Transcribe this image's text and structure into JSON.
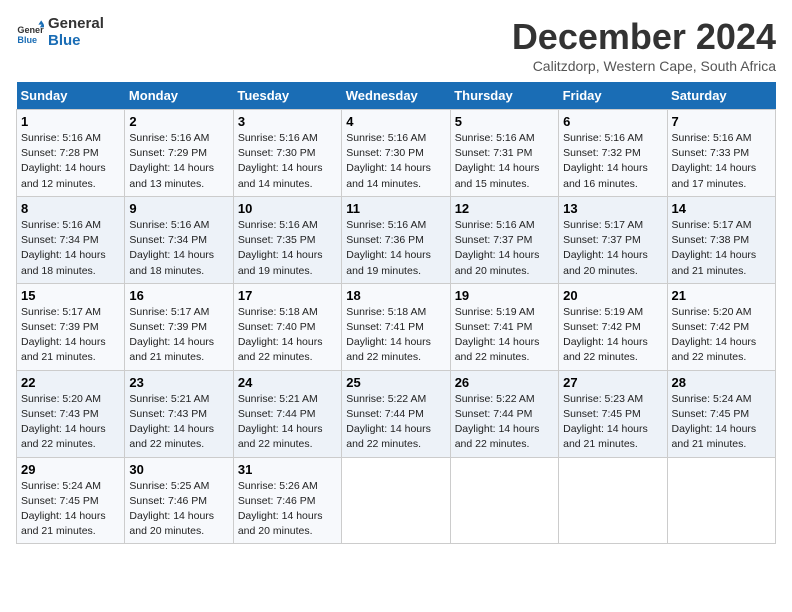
{
  "logo": {
    "line1": "General",
    "line2": "Blue"
  },
  "title": "December 2024",
  "subtitle": "Calitzdorp, Western Cape, South Africa",
  "headers": [
    "Sunday",
    "Monday",
    "Tuesday",
    "Wednesday",
    "Thursday",
    "Friday",
    "Saturday"
  ],
  "weeks": [
    [
      {
        "day": "1",
        "sunrise": "5:16 AM",
        "sunset": "7:28 PM",
        "daylight": "14 hours and 12 minutes."
      },
      {
        "day": "2",
        "sunrise": "5:16 AM",
        "sunset": "7:29 PM",
        "daylight": "14 hours and 13 minutes."
      },
      {
        "day": "3",
        "sunrise": "5:16 AM",
        "sunset": "7:30 PM",
        "daylight": "14 hours and 14 minutes."
      },
      {
        "day": "4",
        "sunrise": "5:16 AM",
        "sunset": "7:30 PM",
        "daylight": "14 hours and 14 minutes."
      },
      {
        "day": "5",
        "sunrise": "5:16 AM",
        "sunset": "7:31 PM",
        "daylight": "14 hours and 15 minutes."
      },
      {
        "day": "6",
        "sunrise": "5:16 AM",
        "sunset": "7:32 PM",
        "daylight": "14 hours and 16 minutes."
      },
      {
        "day": "7",
        "sunrise": "5:16 AM",
        "sunset": "7:33 PM",
        "daylight": "14 hours and 17 minutes."
      }
    ],
    [
      {
        "day": "8",
        "sunrise": "5:16 AM",
        "sunset": "7:34 PM",
        "daylight": "14 hours and 18 minutes."
      },
      {
        "day": "9",
        "sunrise": "5:16 AM",
        "sunset": "7:34 PM",
        "daylight": "14 hours and 18 minutes."
      },
      {
        "day": "10",
        "sunrise": "5:16 AM",
        "sunset": "7:35 PM",
        "daylight": "14 hours and 19 minutes."
      },
      {
        "day": "11",
        "sunrise": "5:16 AM",
        "sunset": "7:36 PM",
        "daylight": "14 hours and 19 minutes."
      },
      {
        "day": "12",
        "sunrise": "5:16 AM",
        "sunset": "7:37 PM",
        "daylight": "14 hours and 20 minutes."
      },
      {
        "day": "13",
        "sunrise": "5:17 AM",
        "sunset": "7:37 PM",
        "daylight": "14 hours and 20 minutes."
      },
      {
        "day": "14",
        "sunrise": "5:17 AM",
        "sunset": "7:38 PM",
        "daylight": "14 hours and 21 minutes."
      }
    ],
    [
      {
        "day": "15",
        "sunrise": "5:17 AM",
        "sunset": "7:39 PM",
        "daylight": "14 hours and 21 minutes."
      },
      {
        "day": "16",
        "sunrise": "5:17 AM",
        "sunset": "7:39 PM",
        "daylight": "14 hours and 21 minutes."
      },
      {
        "day": "17",
        "sunrise": "5:18 AM",
        "sunset": "7:40 PM",
        "daylight": "14 hours and 22 minutes."
      },
      {
        "day": "18",
        "sunrise": "5:18 AM",
        "sunset": "7:41 PM",
        "daylight": "14 hours and 22 minutes."
      },
      {
        "day": "19",
        "sunrise": "5:19 AM",
        "sunset": "7:41 PM",
        "daylight": "14 hours and 22 minutes."
      },
      {
        "day": "20",
        "sunrise": "5:19 AM",
        "sunset": "7:42 PM",
        "daylight": "14 hours and 22 minutes."
      },
      {
        "day": "21",
        "sunrise": "5:20 AM",
        "sunset": "7:42 PM",
        "daylight": "14 hours and 22 minutes."
      }
    ],
    [
      {
        "day": "22",
        "sunrise": "5:20 AM",
        "sunset": "7:43 PM",
        "daylight": "14 hours and 22 minutes."
      },
      {
        "day": "23",
        "sunrise": "5:21 AM",
        "sunset": "7:43 PM",
        "daylight": "14 hours and 22 minutes."
      },
      {
        "day": "24",
        "sunrise": "5:21 AM",
        "sunset": "7:44 PM",
        "daylight": "14 hours and 22 minutes."
      },
      {
        "day": "25",
        "sunrise": "5:22 AM",
        "sunset": "7:44 PM",
        "daylight": "14 hours and 22 minutes."
      },
      {
        "day": "26",
        "sunrise": "5:22 AM",
        "sunset": "7:44 PM",
        "daylight": "14 hours and 22 minutes."
      },
      {
        "day": "27",
        "sunrise": "5:23 AM",
        "sunset": "7:45 PM",
        "daylight": "14 hours and 21 minutes."
      },
      {
        "day": "28",
        "sunrise": "5:24 AM",
        "sunset": "7:45 PM",
        "daylight": "14 hours and 21 minutes."
      }
    ],
    [
      {
        "day": "29",
        "sunrise": "5:24 AM",
        "sunset": "7:45 PM",
        "daylight": "14 hours and 21 minutes."
      },
      {
        "day": "30",
        "sunrise": "5:25 AM",
        "sunset": "7:46 PM",
        "daylight": "14 hours and 20 minutes."
      },
      {
        "day": "31",
        "sunrise": "5:26 AM",
        "sunset": "7:46 PM",
        "daylight": "14 hours and 20 minutes."
      },
      null,
      null,
      null,
      null
    ]
  ],
  "colors": {
    "header_bg": "#1a6db5",
    "row_odd": "#f7f9fc",
    "row_even": "#edf2f8"
  }
}
